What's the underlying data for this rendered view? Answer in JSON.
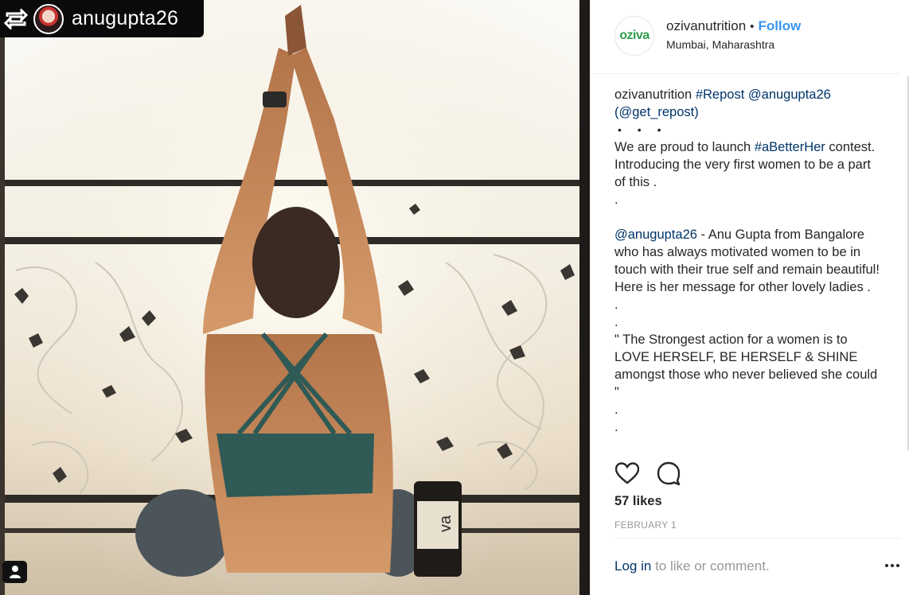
{
  "repost_banner": {
    "username": "anugupta26"
  },
  "post": {
    "author": "ozivanutrition",
    "separator": "•",
    "follow_label": "Follow",
    "location": "Mumbai, Maharashtra",
    "brand_logo_text": "oziva",
    "bottle_label": "va",
    "caption": {
      "author": "ozivanutrition",
      "line1_tag": "#Repost",
      "line1_mention": "@anugupta26",
      "line2_mention": "(@get_repost)",
      "dots": "• • •",
      "p1_prefix": "We are proud to launch",
      "p1_tag": "#aBetterHer",
      "p1_rest": "contest. Introducing the very first women to be a part of this .",
      "dot1": ".",
      "p2_mention": "@anugupta26",
      "p2_rest": "- Anu Gupta from Bangalore who has always motivated women to be in touch with their true self and remain beautiful! Here is her message for other lovely ladies .",
      "dot2": ".",
      "dot3": ".",
      "quote": "\" The Strongest action for a women is to LOVE HERSELF, BE HERSELF & SHINE amongst those who never believed she could \"",
      "dot4": ".",
      "dot5": "."
    },
    "likes": "57 likes",
    "date": "FEBRUARY 1",
    "login_link": "Log in",
    "login_rest": "to like or comment.",
    "more_label": "•••"
  },
  "icons": {
    "repost": "repost-icon",
    "heart": "heart-icon",
    "comment": "comment-icon",
    "user_tag": "user-tag-icon",
    "more": "more-options-icon"
  },
  "colors": {
    "follow": "#3897f0",
    "link": "#003569",
    "muted": "#999999",
    "brand_green": "#2e9e4a"
  }
}
